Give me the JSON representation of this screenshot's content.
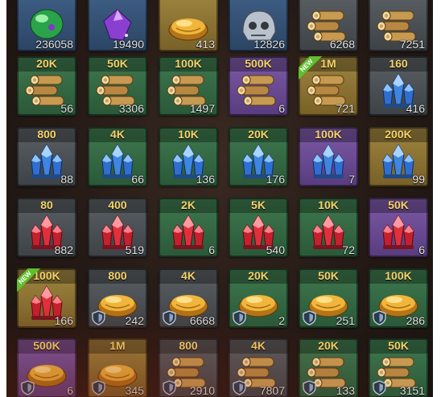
{
  "grid": {
    "rows": [
      [
        {
          "tint": "blue",
          "item": "green-gem",
          "value": "",
          "count": "236058",
          "shield": false,
          "new": false
        },
        {
          "tint": "blue",
          "item": "purple-gem",
          "value": "",
          "count": "19490",
          "shield": false,
          "new": false
        },
        {
          "tint": "gold",
          "item": "bread",
          "value": "",
          "count": "413",
          "shield": false,
          "new": false
        },
        {
          "tint": "blue",
          "item": "stone-skull",
          "value": "",
          "count": "12826",
          "shield": false,
          "new": false
        },
        {
          "tint": "gray",
          "item": "wood",
          "value": "",
          "count": "6268",
          "shield": false,
          "new": false
        },
        {
          "tint": "gray",
          "item": "wood",
          "value": "",
          "count": "7251",
          "shield": false,
          "new": false
        }
      ],
      [
        {
          "tint": "green",
          "item": "wood",
          "value": "20K",
          "count": "56",
          "shield": false,
          "new": false
        },
        {
          "tint": "green",
          "item": "wood",
          "value": "50K",
          "count": "3306",
          "shield": false,
          "new": false
        },
        {
          "tint": "green",
          "item": "wood",
          "value": "100K",
          "count": "1497",
          "shield": false,
          "new": false
        },
        {
          "tint": "purple",
          "item": "wood",
          "value": "500K",
          "count": "6",
          "shield": false,
          "new": false
        },
        {
          "tint": "gold",
          "item": "wood",
          "value": "1M",
          "count": "721",
          "shield": false,
          "new": true
        },
        {
          "tint": "gray",
          "item": "blue-crystal",
          "value": "160",
          "count": "416",
          "shield": false,
          "new": false
        }
      ],
      [
        {
          "tint": "gray",
          "item": "blue-crystal",
          "value": "800",
          "count": "88",
          "shield": false,
          "new": false
        },
        {
          "tint": "green",
          "item": "blue-crystal",
          "value": "4K",
          "count": "66",
          "shield": false,
          "new": false
        },
        {
          "tint": "green",
          "item": "blue-crystal",
          "value": "10K",
          "count": "136",
          "shield": false,
          "new": false
        },
        {
          "tint": "green",
          "item": "blue-crystal",
          "value": "20K",
          "count": "176",
          "shield": false,
          "new": false
        },
        {
          "tint": "purple",
          "item": "blue-crystal",
          "value": "100K",
          "count": "7",
          "shield": false,
          "new": false
        },
        {
          "tint": "gold",
          "item": "blue-crystal",
          "value": "200K",
          "count": "99",
          "shield": false,
          "new": false
        }
      ],
      [
        {
          "tint": "gray",
          "item": "red-crystal",
          "value": "80",
          "count": "882",
          "shield": false,
          "new": false
        },
        {
          "tint": "gray",
          "item": "red-crystal",
          "value": "400",
          "count": "519",
          "shield": false,
          "new": false
        },
        {
          "tint": "green",
          "item": "red-crystal",
          "value": "2K",
          "count": "6",
          "shield": false,
          "new": false
        },
        {
          "tint": "green",
          "item": "red-crystal",
          "value": "5K",
          "count": "540",
          "shield": false,
          "new": false
        },
        {
          "tint": "green",
          "item": "red-crystal",
          "value": "10K",
          "count": "72",
          "shield": false,
          "new": false
        },
        {
          "tint": "purple",
          "item": "red-crystal",
          "value": "50K",
          "count": "6",
          "shield": false,
          "new": false
        }
      ],
      [
        {
          "tint": "gold",
          "item": "red-crystal",
          "value": "100K",
          "count": "166",
          "shield": false,
          "new": true
        },
        {
          "tint": "gray",
          "item": "bread",
          "value": "800",
          "count": "242",
          "shield": true,
          "new": false
        },
        {
          "tint": "gray",
          "item": "bread",
          "value": "4K",
          "count": "6668",
          "shield": true,
          "new": false
        },
        {
          "tint": "green",
          "item": "bread",
          "value": "20K",
          "count": "2",
          "shield": true,
          "new": false
        },
        {
          "tint": "green",
          "item": "bread",
          "value": "50K",
          "count": "251",
          "shield": true,
          "new": false
        },
        {
          "tint": "green",
          "item": "bread",
          "value": "100K",
          "count": "286",
          "shield": true,
          "new": false
        }
      ],
      [
        {
          "tint": "purple",
          "item": "bread",
          "value": "500K",
          "count": "6",
          "shield": true,
          "new": false
        },
        {
          "tint": "gold",
          "item": "bread",
          "value": "1M",
          "count": "345",
          "shield": true,
          "new": false
        },
        {
          "tint": "gray",
          "item": "wood",
          "value": "800",
          "count": "2910",
          "shield": true,
          "new": false
        },
        {
          "tint": "gray",
          "item": "wood",
          "value": "4K",
          "count": "7807",
          "shield": true,
          "new": false
        },
        {
          "tint": "green",
          "item": "wood",
          "value": "20K",
          "count": "133",
          "shield": true,
          "new": false
        },
        {
          "tint": "green",
          "item": "wood",
          "value": "50K",
          "count": "3151",
          "shield": true,
          "new": false
        }
      ]
    ]
  },
  "new_badge_label": "NEW",
  "colors": {
    "value_text": "#f7d36a",
    "count_text": "#e6e6e6",
    "new_ribbon": "#5fc02c",
    "tint_gray": "#4c5155",
    "tint_green": "#356a44",
    "tint_purple": "#6b4b93",
    "tint_gold": "#8c7334",
    "tint_blue": "#355174"
  }
}
